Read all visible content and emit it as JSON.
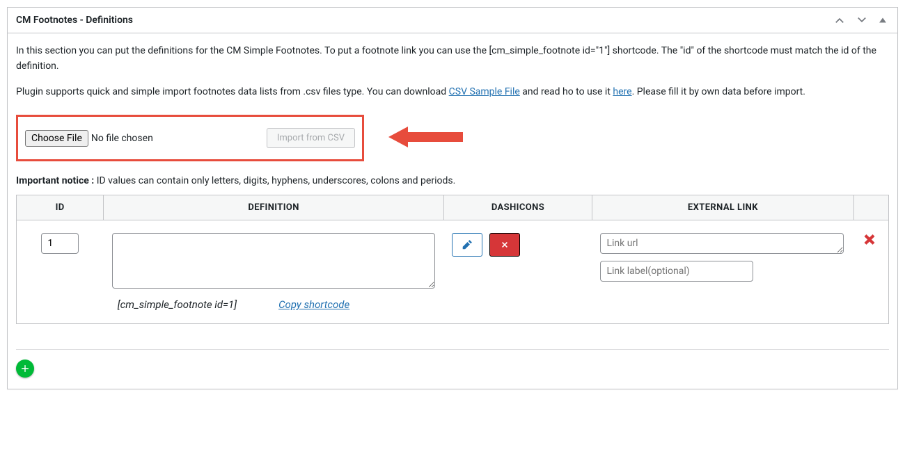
{
  "panel": {
    "title": "CM Footnotes - Definitions"
  },
  "intro": {
    "p1": "In this section you can put the definitions for the CM Simple Footnotes. To put a footnote link you can use the [cm_simple_footnote id=\"1\"] shortcode. The \"id\" of the shortcode must match the id of the definition.",
    "p2_a": "Plugin supports quick and simple import footnotes data lists from .csv files type.  You can download ",
    "p2_link1": "CSV Sample File",
    "p2_b": "  and read ho to use it ",
    "p2_link2": "here",
    "p2_c": ".  Please fill it by own data before import."
  },
  "upload": {
    "choose_label": "Choose File",
    "no_file": "No file chosen",
    "import_label": "Import from CSV"
  },
  "notice": {
    "bold": "Important notice :",
    "text": " ID values can contain only letters, digits, hyphens, underscores, colons and periods."
  },
  "table": {
    "headers": {
      "id": "ID",
      "def": "DEFINITION",
      "dash": "DASHICONS",
      "link": "EXTERNAL LINK"
    }
  },
  "row": {
    "id": "1",
    "definition": "",
    "shortcode": "[cm_simple_footnote id=1]",
    "copy_label": "Copy shortcode",
    "link_url_placeholder": "Link url",
    "link_label_placeholder": "Link label(optional)",
    "link_url": "",
    "link_label": ""
  }
}
